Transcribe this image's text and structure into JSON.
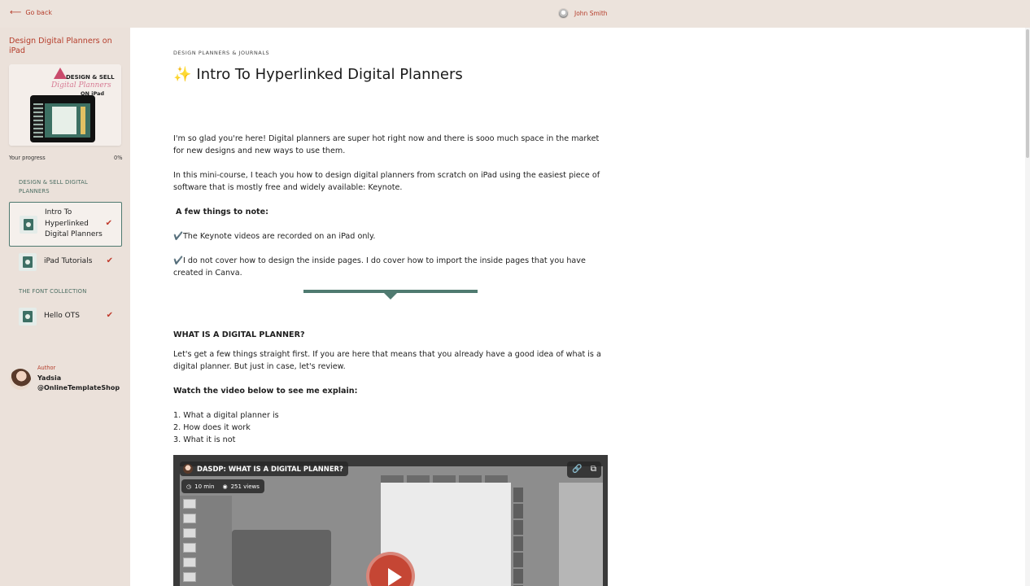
{
  "topbar": {
    "go_back": "Go back",
    "user_name": "John Smith"
  },
  "sidebar": {
    "course_title": "Design Digital Planners on iPad",
    "thumbnail": {
      "line1": "DESIGN & SELL",
      "line2": "Digital Planners",
      "line3": "ON iPad"
    },
    "progress_label": "Your progress",
    "progress_value": "0%",
    "sections": [
      {
        "label": "DESIGN & SELL DIGITAL PLANNERS",
        "lessons": [
          {
            "label": "Intro To Hyperlinked Digital Planners",
            "completed": true,
            "active": true
          },
          {
            "label": "iPad Tutorials",
            "completed": true,
            "active": false
          }
        ]
      },
      {
        "label": "THE FONT COLLECTION",
        "lessons": [
          {
            "label": "Hello OTS",
            "completed": true,
            "active": false
          }
        ]
      }
    ],
    "author": {
      "label": "Author",
      "name": "Yadsia @OnlineTemplateShop"
    }
  },
  "main": {
    "kicker": "DESIGN PLANNERS & JOURNALS",
    "title_icon": "sparkles-icon",
    "title": "Intro To Hyperlinked Digital Planners",
    "paragraphs": {
      "p1": "I'm so glad you're here! Digital planners are super hot right now and there is sooo much space in the market for new designs and new ways to use them.",
      "p2": "In this mini-course, I teach you how to design digital planners from scratch on iPad using the easiest piece of software that is mostly free and widely available: Keynote.",
      "p3": "A few things to note:",
      "p4": "✔️The Keynote videos are recorded on an iPad only.",
      "p5": "✔️I do not cover how to design the inside pages. I do cover how to import the inside pages that you have created in Canva.",
      "p6": "WHAT IS A DIGITAL PLANNER?",
      "p7": "Let's get a few things straight first. If you are here that means that you already have a good idea of what is a digital planner. But just in case, let's review.",
      "p8": "Watch the video below to see me explain:",
      "list1": "1. What a digital planner is",
      "list2": "2. How does it work",
      "list3": "3. What it is not"
    },
    "video": {
      "title": "DASDP: WHAT IS A DIGITAL PLANNER?",
      "duration": "10 min",
      "views": "251 views"
    }
  },
  "colors": {
    "accent": "#b53d2b",
    "teal": "#4f7a70",
    "sidebar_bg": "#ebe1da",
    "play": "#c54634"
  }
}
